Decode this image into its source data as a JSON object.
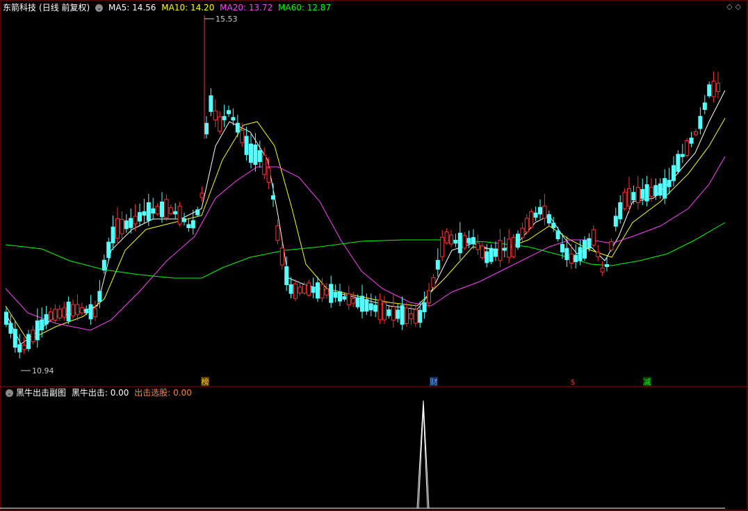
{
  "main_chart": {
    "stock_name": "东箭科技",
    "period_label": "(日线 前复权)",
    "ma_labels": [
      {
        "label": "MA5: 14.56",
        "color": "#ffffff"
      },
      {
        "label": "MA10: 14.20",
        "color": "#ffff00"
      },
      {
        "label": "MA20: 13.72",
        "color": "#ff40ff"
      },
      {
        "label": "MA60: 12.87",
        "color": "#00ff00"
      }
    ],
    "high_marker": "15.53",
    "low_marker": "10.94",
    "event_markers": [
      {
        "label": "榜",
        "color": "#ffcc00",
        "bg": "#5a3a00"
      },
      {
        "label": "财",
        "color": "#66aaff",
        "bg": "#102a5a"
      },
      {
        "label": "$",
        "color": "#ff3030",
        "bg": "#000000"
      },
      {
        "label": "减",
        "color": "#00ff00",
        "bg": "#003a00"
      }
    ],
    "colors": {
      "up": "#ff3030",
      "down": "#54ffff",
      "frame": "#a00000"
    }
  },
  "sub_chart": {
    "title": "黑牛出击副图",
    "signal_label": "黑牛出击: 0.00",
    "select_label": "出击选股: 0.00"
  },
  "icons": {
    "header_toggle": "chevron-down-icon",
    "window_controls": "diamond-icon"
  }
}
